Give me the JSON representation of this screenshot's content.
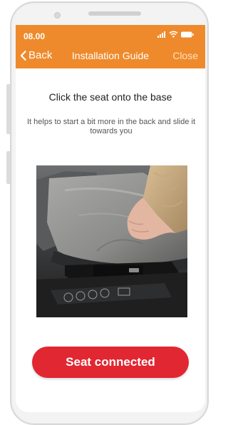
{
  "status_bar": {
    "time": "08.00",
    "icons": [
      "signal-icon",
      "wifi-icon",
      "battery-icon"
    ]
  },
  "nav": {
    "back_label": "Back",
    "title": "Installation Guide",
    "close_label": "Close"
  },
  "step": {
    "title": "Click the seat onto the base",
    "description": "It helps to start a bit more in the back and slide it towards you"
  },
  "photo": {
    "subject": "hand-pressing-car-seat-onto-base"
  },
  "action": {
    "button_label": "Seat connected"
  },
  "colors": {
    "header": "#ee8a2c",
    "button": "#e02732",
    "text": "#222222"
  }
}
